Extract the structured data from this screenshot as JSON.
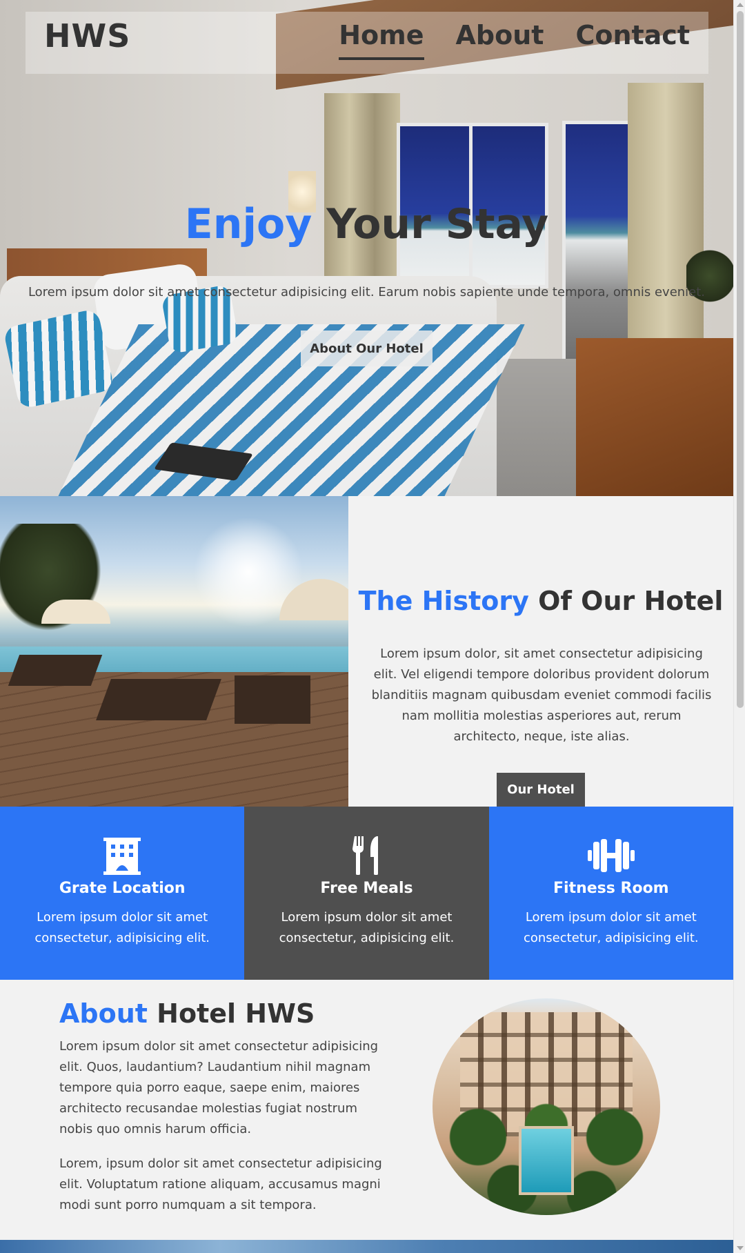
{
  "brand": {
    "logo": "HWS"
  },
  "nav": {
    "items": [
      "Home",
      "About",
      "Contact"
    ],
    "active": "Home"
  },
  "hero": {
    "title_highlight": "Enjoy",
    "title_rest": " Your Stay",
    "text": "Lorem ipsum dolor sit amet consectetur adipisicing elit. Earum nobis sapiente unde tempora, omnis eveniet.",
    "button": "About Our Hotel"
  },
  "history": {
    "title_highlight": "The History",
    "title_rest": " Of Our Hotel",
    "text": "Lorem ipsum dolor, sit amet consectetur adipisicing elit. Vel eligendi tempore doloribus provident dolorum blanditiis magnam quibusdam eveniet commodi facilis nam mollitia molestias asperiores aut, rerum architecto, neque, iste alias.",
    "button": "Our Hotel"
  },
  "features": [
    {
      "icon": "hotel-building-icon",
      "title": "Grate Location",
      "text": "Lorem ipsum dolor sit amet consectetur, adipisicing elit."
    },
    {
      "icon": "utensils-icon",
      "title": "Free Meals",
      "text": "Lorem ipsum dolor sit amet consectetur, adipisicing elit."
    },
    {
      "icon": "dumbbell-icon",
      "title": "Fitness Room",
      "text": "Lorem ipsum dolor sit amet consectetur, adipisicing elit."
    }
  ],
  "about": {
    "title_highlight": "About",
    "title_rest": " Hotel HWS",
    "p1": "Lorem ipsum dolor sit amet consectetur adipisicing elit. Quos, laudantium? Laudantium nihil magnam tempore quia porro eaque, saepe enim, maiores architecto recusandae molestias fugiat nostrum nobis quo omnis harum officia.",
    "p2": "Lorem, ipsum dolor sit amet consectetur adipisicing elit. Voluptatum ratione aliquam, accusamus magni modi sunt porro numquam a sit tempora."
  },
  "colors": {
    "accent": "#2c75f5",
    "dark": "#4f4f4f",
    "text": "#333333",
    "background": "#f2f2f2"
  }
}
